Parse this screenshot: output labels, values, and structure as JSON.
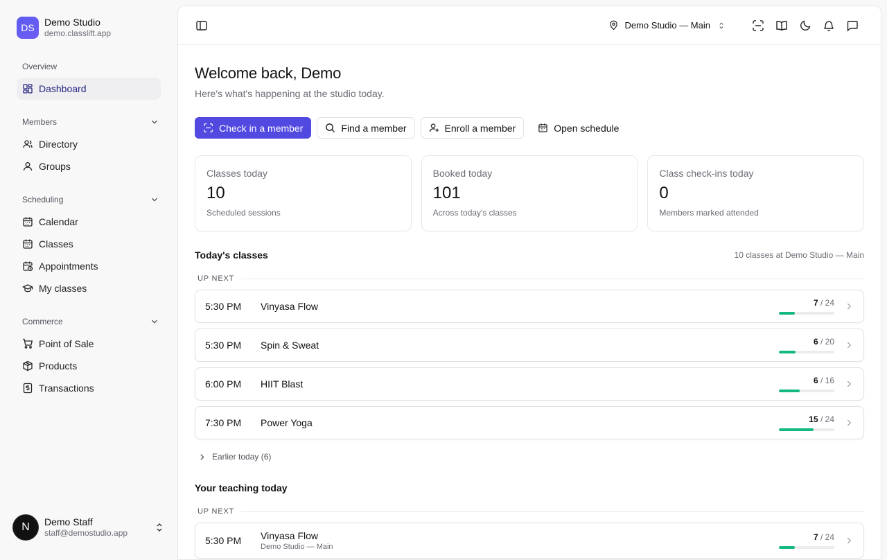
{
  "brand": {
    "initials": "DS",
    "name": "Demo Studio",
    "domain": "demo.classlift.app"
  },
  "nav": {
    "overview": {
      "heading": "Overview",
      "items": [
        {
          "label": "Dashboard",
          "icon": "dashboard-icon"
        }
      ]
    },
    "members": {
      "heading": "Members",
      "items": [
        {
          "label": "Directory",
          "icon": "user-icon"
        },
        {
          "label": "Groups",
          "icon": "users-icon"
        }
      ]
    },
    "scheduling": {
      "heading": "Scheduling",
      "items": [
        {
          "label": "Calendar"
        },
        {
          "label": "Classes"
        },
        {
          "label": "Appointments"
        },
        {
          "label": "My classes"
        }
      ]
    },
    "commerce": {
      "heading": "Commerce",
      "items": [
        {
          "label": "Point of Sale"
        },
        {
          "label": "Products"
        },
        {
          "label": "Transactions"
        }
      ]
    }
  },
  "user": {
    "initial": "N",
    "name": "Demo Staff",
    "email": "staff@demostudio.app"
  },
  "topbar": {
    "location": "Demo Studio — Main"
  },
  "welcome": {
    "title": "Welcome back, Demo",
    "subtitle": "Here's what's happening at the studio today."
  },
  "actions": {
    "check_in": "Check in a member",
    "find": "Find a member",
    "enroll": "Enroll a member",
    "schedule": "Open schedule"
  },
  "stats": [
    {
      "label": "Classes today",
      "value": "10",
      "desc": "Scheduled sessions"
    },
    {
      "label": "Booked today",
      "value": "101",
      "desc": "Across today's classes"
    },
    {
      "label": "Class check-ins today",
      "value": "0",
      "desc": "Members marked attended"
    }
  ],
  "todays_classes": {
    "title": "Today's classes",
    "note": "10 classes at Demo Studio — Main",
    "up_next_label": "UP NEXT",
    "classes": [
      {
        "time": "5:30 PM",
        "name": "Vinyasa Flow",
        "booked": "7",
        "capacity": "/ 24",
        "fill": 0.29
      },
      {
        "time": "5:30 PM",
        "name": "Spin & Sweat",
        "booked": "6",
        "capacity": "/ 20",
        "fill": 0.3
      },
      {
        "time": "6:00 PM",
        "name": "HIIT Blast",
        "booked": "6",
        "capacity": "/ 16",
        "fill": 0.375
      },
      {
        "time": "7:30 PM",
        "name": "Power Yoga",
        "booked": "15",
        "capacity": "/ 24",
        "fill": 0.625
      }
    ],
    "earlier": "Earlier today (6)"
  },
  "teaching": {
    "title": "Your teaching today",
    "up_next_label": "UP NEXT",
    "classes": [
      {
        "time": "5:30 PM",
        "name": "Vinyasa Flow",
        "location": "Demo Studio — Main",
        "booked": "7",
        "capacity": "/ 24",
        "fill": 0.29
      }
    ]
  },
  "colors": {
    "primary": "#5149e0",
    "progress": "#14b881",
    "active_nav_bg": "#efeff2"
  }
}
